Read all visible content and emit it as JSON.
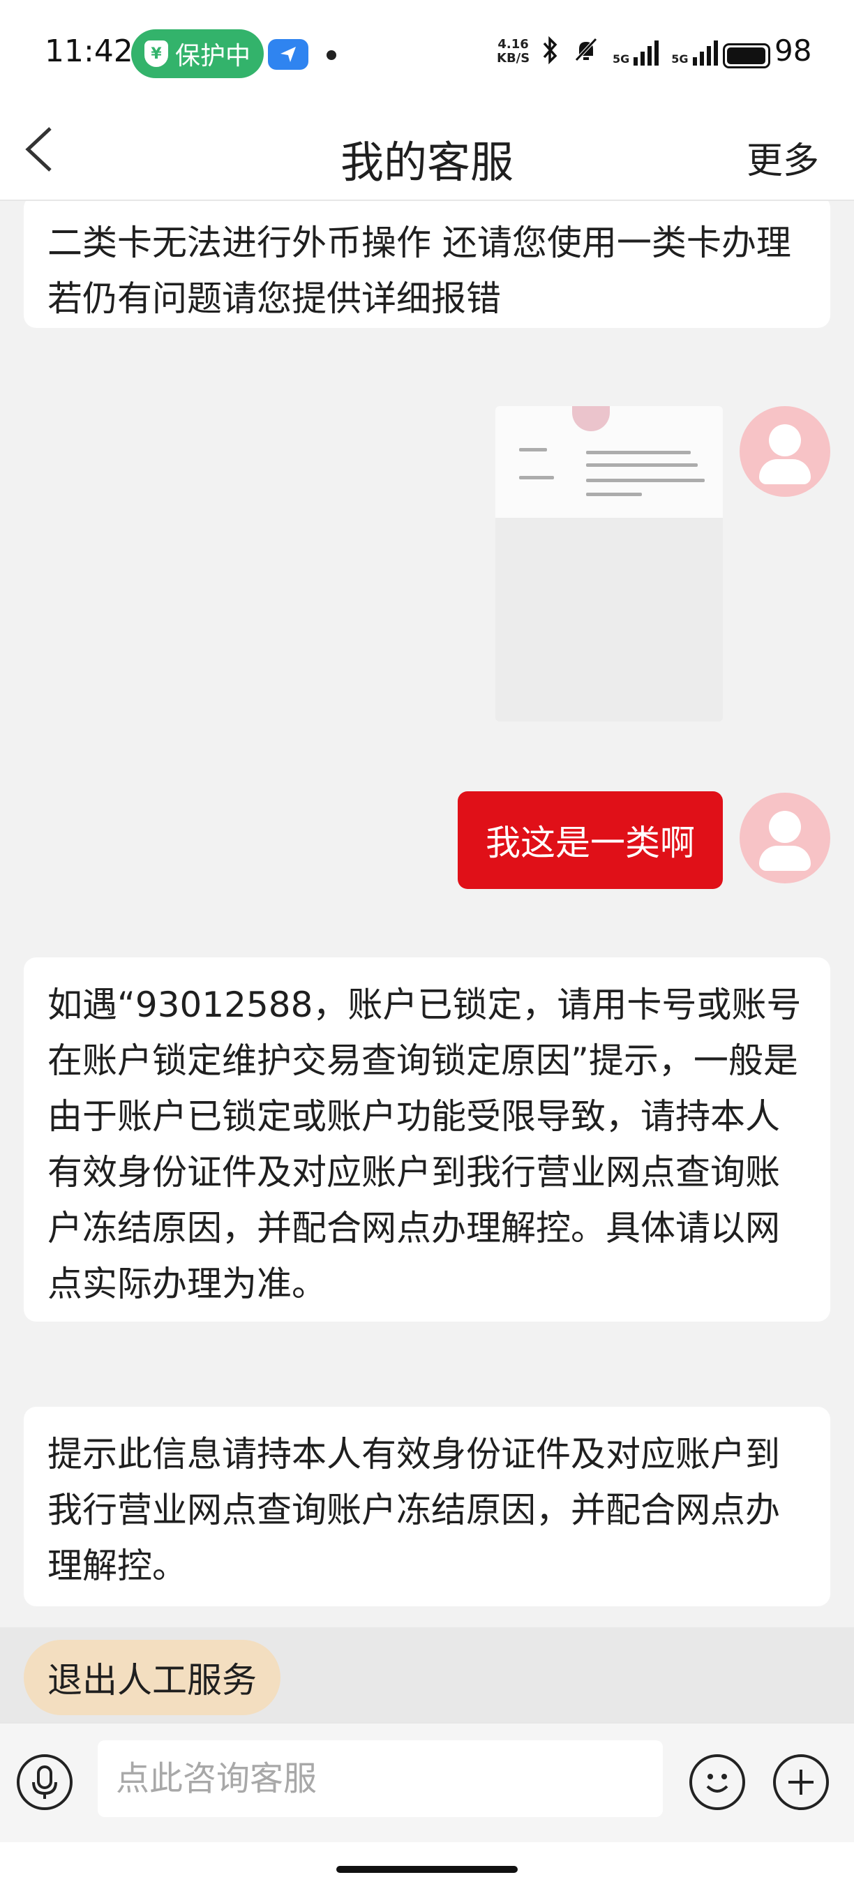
{
  "status_bar": {
    "time": "11:42",
    "protect_label": "保护中",
    "net_speed_value": "4.16",
    "net_speed_unit": "KB/S",
    "network_1": "5G",
    "network_2": "5G",
    "battery": "98"
  },
  "header": {
    "title": "我的客服",
    "more": "更多"
  },
  "messages": [
    {
      "side": "left",
      "text": "二类卡无法进行外币操作 还请您使用一类卡办理 若仍有问题请您提供详细报错"
    },
    {
      "side": "right",
      "type": "image"
    },
    {
      "side": "right",
      "text": "我这是一类啊"
    },
    {
      "side": "left",
      "text": "如遇“93012588，账户已锁定，请用卡号或账号在账户锁定维护交易查询锁定原因”提示，一般是由于账户已锁定或账户功能受限导致，请持本人有效身份证件及对应账户到我行营业网点查询账户冻结原因，并配合网点办理解控。具体请以网点实际办理为准。"
    },
    {
      "side": "left",
      "text": "提示此信息请持本人有效身份证件及对应账户到我行营业网点查询账户冻结原因，并配合网点办理解控。"
    }
  ],
  "service_bar": {
    "exit_label": "退出人工服务"
  },
  "input_bar": {
    "placeholder": "点此咨询客服",
    "value": ""
  },
  "colors": {
    "accent_red": "#e01018",
    "protect_green": "#33b36b",
    "avatar_pink": "#f7c3c6",
    "exit_button": "#f3dec0"
  },
  "icons": [
    "back-arrow-icon",
    "shield-icon",
    "navigation-arrow-icon",
    "bluetooth-icon",
    "mute-bell-icon",
    "signal-icon",
    "battery-icon",
    "user-avatar-icon",
    "microphone-icon",
    "emoji-icon",
    "plus-icon"
  ]
}
